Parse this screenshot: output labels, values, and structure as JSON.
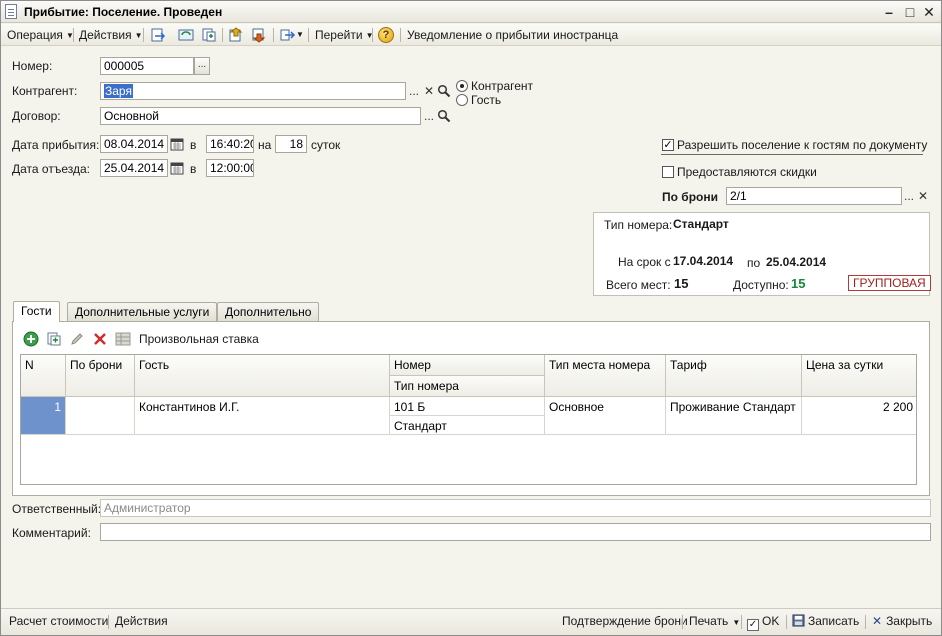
{
  "window": {
    "title": "Прибытие: Поселение. Проведен"
  },
  "toolbar": {
    "operation": "Операция",
    "actions": "Действия",
    "goto": "Перейти",
    "notice": "Уведомление о прибытии иностранца"
  },
  "form": {
    "number_label": "Номер:",
    "number_value": "000005",
    "contragent_label": "Контрагент:",
    "contragent_value": "Заря",
    "contract_label": "Договор:",
    "contract_value": "Основной",
    "radio_contragent": "Контрагент",
    "radio_guest": "Гость",
    "arrival_label": "Дата прибытия:",
    "arrival_date": "08.04.2014",
    "in_label": "в",
    "arrival_time": "16:40:20",
    "on_label": "на",
    "nights": "18",
    "days_label": "суток",
    "departure_label": "Дата отъезда:",
    "departure_date": "25.04.2014",
    "departure_time": "12:00:00",
    "allow_checkin_label": "Разрешить поселение к гостям по документу",
    "discounts_label": "Предоставляются скидки",
    "booking_label": "По брони",
    "booking_value": "2/1"
  },
  "room_panel": {
    "room_type_label": "Тип номера:",
    "room_type_value": "Стандарт",
    "period_label": "На срок с",
    "period_from": "17.04.2014",
    "period_to_label": "по",
    "period_to": "25.04.2014",
    "total_label": "Всего мест:",
    "total_value": "15",
    "available_label": "Доступно:",
    "available_value": "15",
    "group_badge": "ГРУППОВАЯ",
    "available_color": "#16873a"
  },
  "tabs": [
    {
      "label": "Гости"
    },
    {
      "label": "Дополнительные услуги"
    },
    {
      "label": "Дополнительно"
    }
  ],
  "grid_toolbar": {
    "custom_rate": "Произвольная ставка"
  },
  "grid": {
    "headers": {
      "n": "N",
      "booking": "По брони",
      "guest": "Гость",
      "room": "Номер",
      "room_type": "Тип номера",
      "place_type": "Тип места номера",
      "tariff": "Тариф",
      "price": "Цена за сутки"
    },
    "rows": [
      {
        "n": "1",
        "booking": "",
        "guest": "Константинов И.Г.",
        "room": "101 Б",
        "room_type": "Стандарт",
        "place_type": "Основное",
        "tariff": "Проживание Стандарт",
        "price": "2 200"
      }
    ]
  },
  "bottom": {
    "responsible_label": "Ответственный:",
    "responsible_value": "Администратор",
    "comment_label": "Комментарий:",
    "comment_value": ""
  },
  "footer": {
    "calc_cost": "Расчет стоимости",
    "actions": "Действия",
    "confirm_booking": "Подтверждение брони",
    "print": "Печать",
    "ok": "OK",
    "save": "Записать",
    "close": "Закрыть"
  }
}
